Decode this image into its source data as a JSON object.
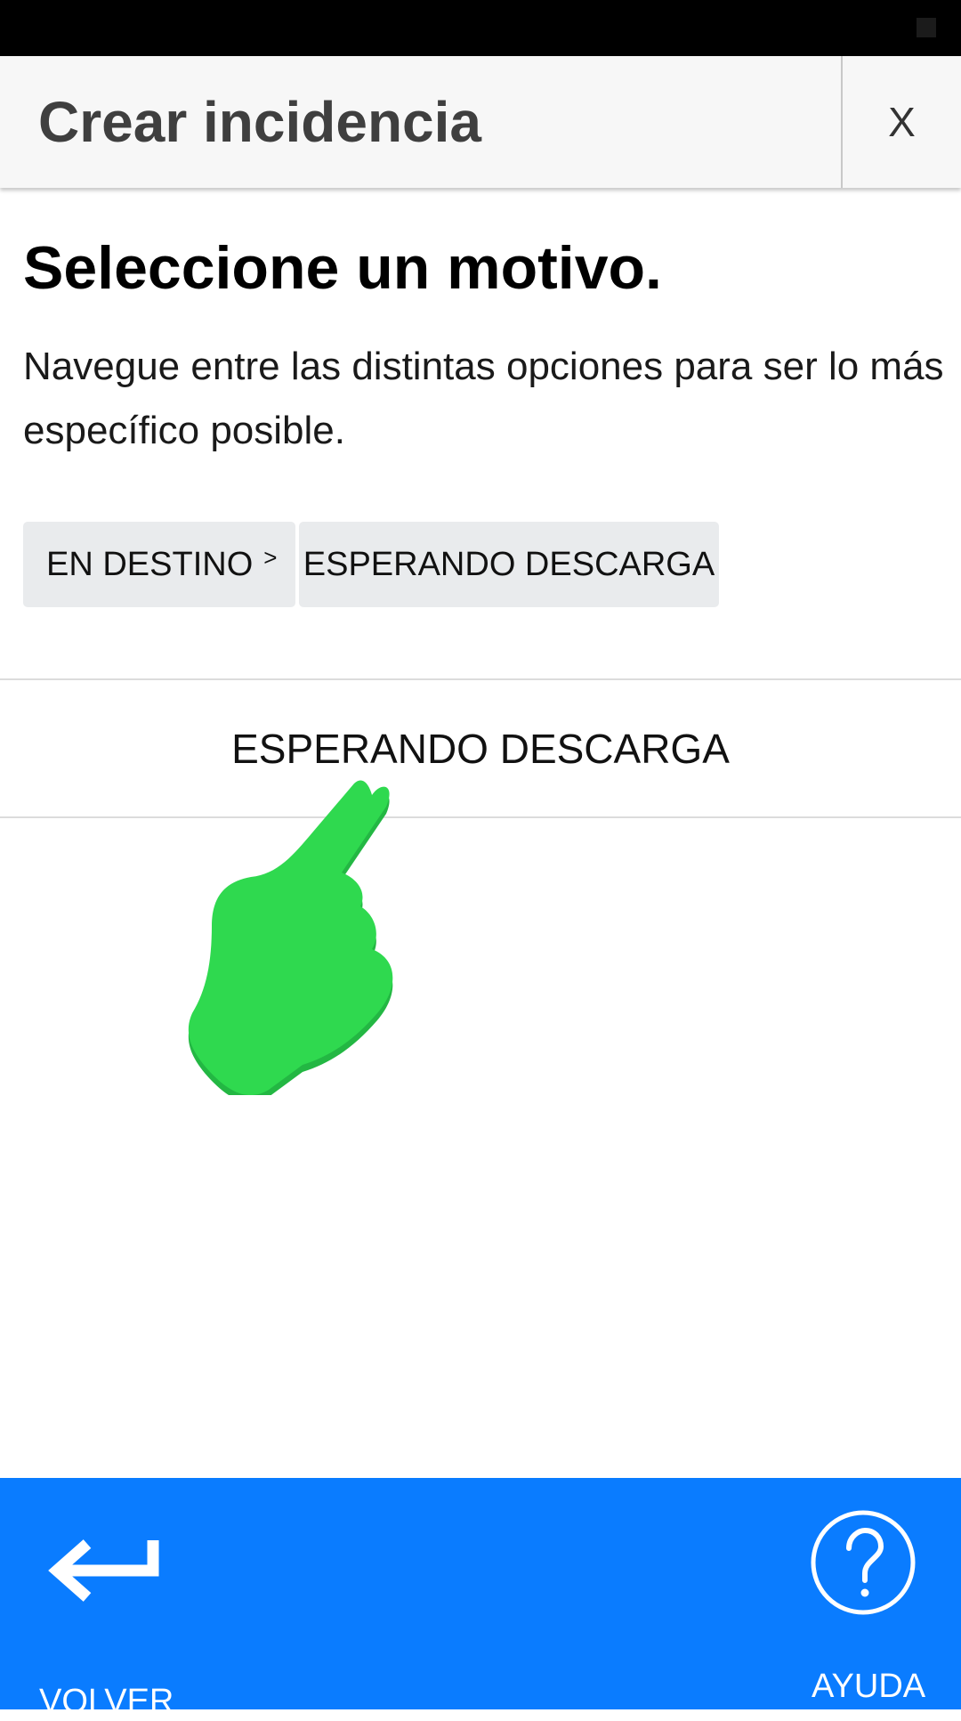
{
  "header": {
    "title": "Crear incidencia",
    "close_label": "X"
  },
  "main": {
    "heading": "Seleccione un motivo.",
    "subtitle": "Navegue entre las distintas opciones para ser lo más específico posible.",
    "breadcrumbs": [
      {
        "label": "EN DESTINO",
        "chevron": ">"
      },
      {
        "label": "ESPERANDO DESCARGA"
      }
    ],
    "options": [
      {
        "label": "ESPERANDO DESCARGA"
      }
    ]
  },
  "bottom_bar": {
    "back_label": "VOLVER",
    "help_label": "AYUDA",
    "back_icon": "return-arrow-icon",
    "help_icon": "question-circle-icon"
  },
  "overlay": {
    "pointer_icon": "hand-pointer-icon"
  },
  "colors": {
    "accent": "#0a7cff",
    "header_bg": "#f7f7f7",
    "chip_bg": "#e9ebed",
    "pointer": "#2fd94f"
  }
}
